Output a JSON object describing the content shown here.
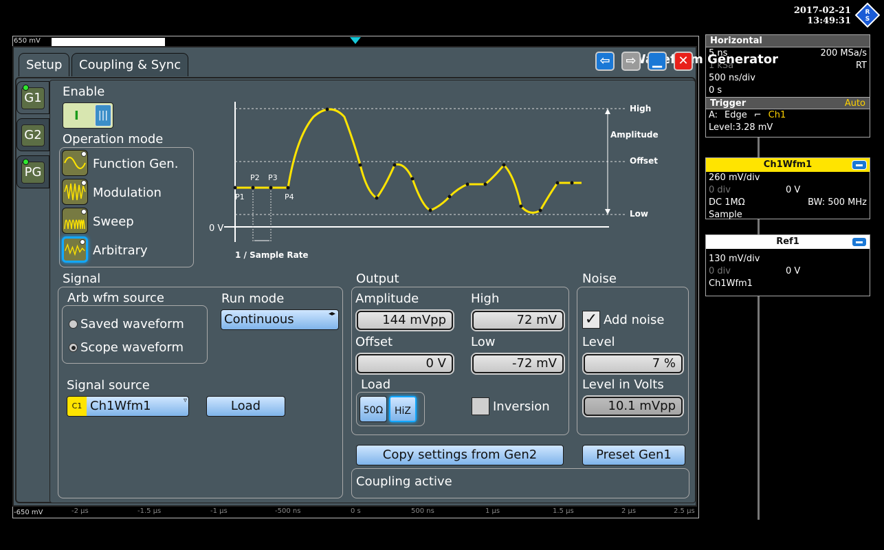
{
  "header": {
    "date": "2017-02-21",
    "time": "13:49:31"
  },
  "scope": {
    "top_level": "650 mV",
    "bottom_level": "-650 mV",
    "x_ticks": [
      "-2 µs",
      "-1.5 µs",
      "-1 µs",
      "-500 ns",
      "0 s",
      "500 ns",
      "1 µs",
      "1.5 µs",
      "2 µs",
      "2.5 µs"
    ]
  },
  "horizontal": {
    "title": "Horizontal",
    "time_scale": "5 ns",
    "sample_rate": "200 MSa/s",
    "record_length": "1 kSa",
    "mode": "RT",
    "time_div": "500 ns/div",
    "position": "0 s"
  },
  "trigger": {
    "title": "Trigger",
    "mode": "Auto",
    "source_prefix": "A:",
    "type": "Edge",
    "channel": "Ch1",
    "level": "Level:3.28 mV"
  },
  "ch1wfm1": {
    "title": "Ch1Wfm1",
    "scale": "260 mV/div",
    "offset_div": "0 div",
    "offset_v": "0 V",
    "coupling": "DC 1MΩ",
    "bandwidth": "BW: 500 MHz",
    "acq": "Sample"
  },
  "ref1": {
    "title": "Ref1",
    "scale": "130 mV/div",
    "offset_div": "0 div",
    "offset_v": "0 V",
    "source": "Ch1Wfm1"
  },
  "dialog": {
    "title": "Waveform Generator",
    "tabs": [
      "Setup",
      "Coupling & Sync"
    ],
    "gen_tabs": [
      "G1",
      "G2",
      "PG"
    ],
    "enable_label": "Enable",
    "toggle_on": "I",
    "operation_mode_label": "Operation mode",
    "modes": [
      "Function Gen.",
      "Modulation",
      "Sweep",
      "Arbitrary"
    ],
    "diagram": {
      "high": "High",
      "amplitude": "Amplitude",
      "offset": "Offset",
      "low": "Low",
      "zero": "0 V",
      "rate": "1 / Sample Rate",
      "points": [
        "P1",
        "P2",
        "P3",
        "P4"
      ]
    },
    "signal": {
      "label": "Signal",
      "arb_source_label": "Arb wfm source",
      "saved": "Saved waveform",
      "scope": "Scope waveform",
      "run_mode_label": "Run mode",
      "run_mode": "Continuous",
      "signal_source_label": "Signal source",
      "source_badge": "C1",
      "source": "Ch1Wfm1",
      "load_button": "Load"
    },
    "output": {
      "label": "Output",
      "amplitude_label": "Amplitude",
      "amplitude": "144 mVpp",
      "high_label": "High",
      "high": "72 mV",
      "offset_label": "Offset",
      "offset": "0 V",
      "low_label": "Low",
      "low": "-72 mV",
      "load_label": "Load",
      "load_50": "50Ω",
      "load_hiz": "HiZ",
      "inversion": "Inversion"
    },
    "noise": {
      "label": "Noise",
      "add_noise": "Add noise",
      "level_label": "Level",
      "level": "7 %",
      "level_volts_label": "Level in Volts",
      "level_volts": "10.1 mVpp"
    },
    "copy_button": "Copy settings from Gen2",
    "preset_button": "Preset Gen1",
    "status": "Coupling active"
  }
}
